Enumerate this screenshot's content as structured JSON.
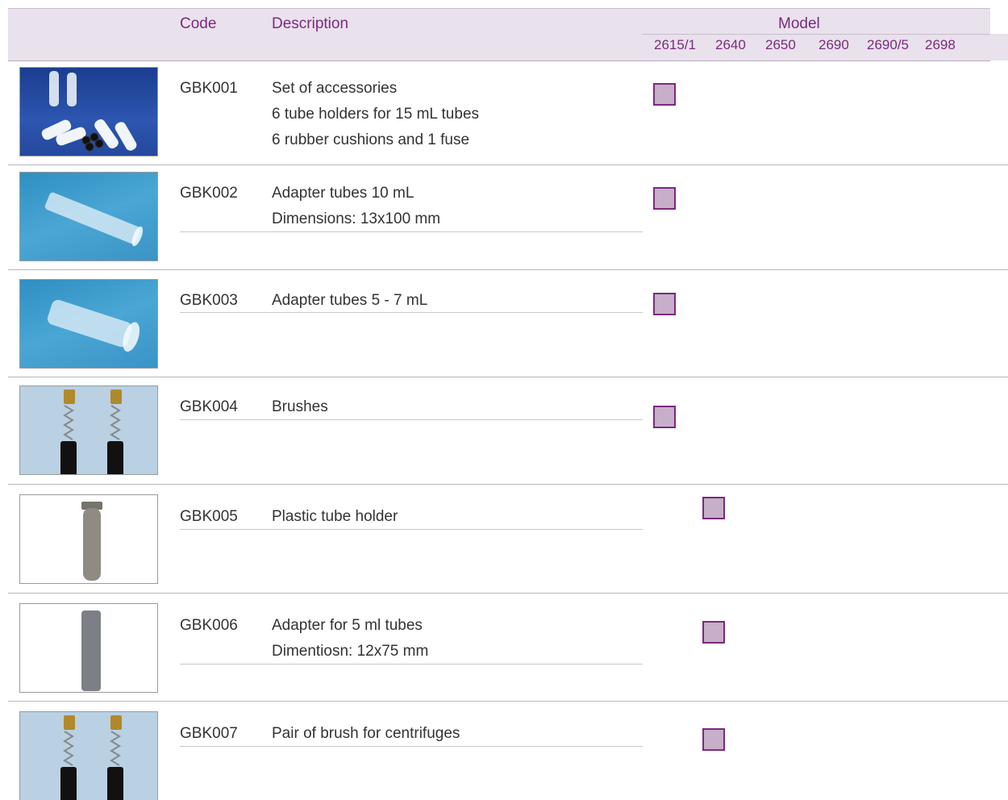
{
  "header": {
    "code_label": "Code",
    "description_label": "Description",
    "model_label": "Model",
    "models": [
      "2615/1",
      "2640",
      "2650",
      "2690",
      "2690/5",
      "2698"
    ]
  },
  "colors": {
    "accent": "#7a2a7e",
    "header_bg": "#e9e1ec",
    "check_fill": "#c7aec9"
  },
  "rows": [
    {
      "code": "GBK001",
      "lines": [
        "Set of accessories",
        "6 tube holders for 15 mL tubes",
        "6 rubber cushions and 1 fuse"
      ],
      "image": "tube-holders-set-photo",
      "model": "2615/1"
    },
    {
      "code": "GBK002",
      "lines": [
        "Adapter tubes 10 mL",
        "Dimensions: 13x100 mm"
      ],
      "image": "adapter-tube-10ml-photo",
      "model": "2615/1"
    },
    {
      "code": "GBK003",
      "lines": [
        "Adapter tubes 5 - 7 mL"
      ],
      "image": "adapter-tube-5-7ml-photo",
      "model": "2615/1"
    },
    {
      "code": "GBK004",
      "lines": [
        "Brushes"
      ],
      "image": "carbon-brushes-photo",
      "model": "2615/1"
    },
    {
      "code": "GBK005",
      "lines": [
        "Plastic tube holder"
      ],
      "image": "plastic-tube-holder-photo",
      "model": "2640"
    },
    {
      "code": "GBK006",
      "lines": [
        "Adapter for 5 ml tubes",
        "Dimentiosn: 12x75 mm"
      ],
      "image": "grey-adapter-photo",
      "model": "2640"
    },
    {
      "code": "GBK007",
      "lines": [
        "Pair of brush for centrifuges"
      ],
      "image": "carbon-brushes-photo",
      "model": "2640"
    }
  ]
}
